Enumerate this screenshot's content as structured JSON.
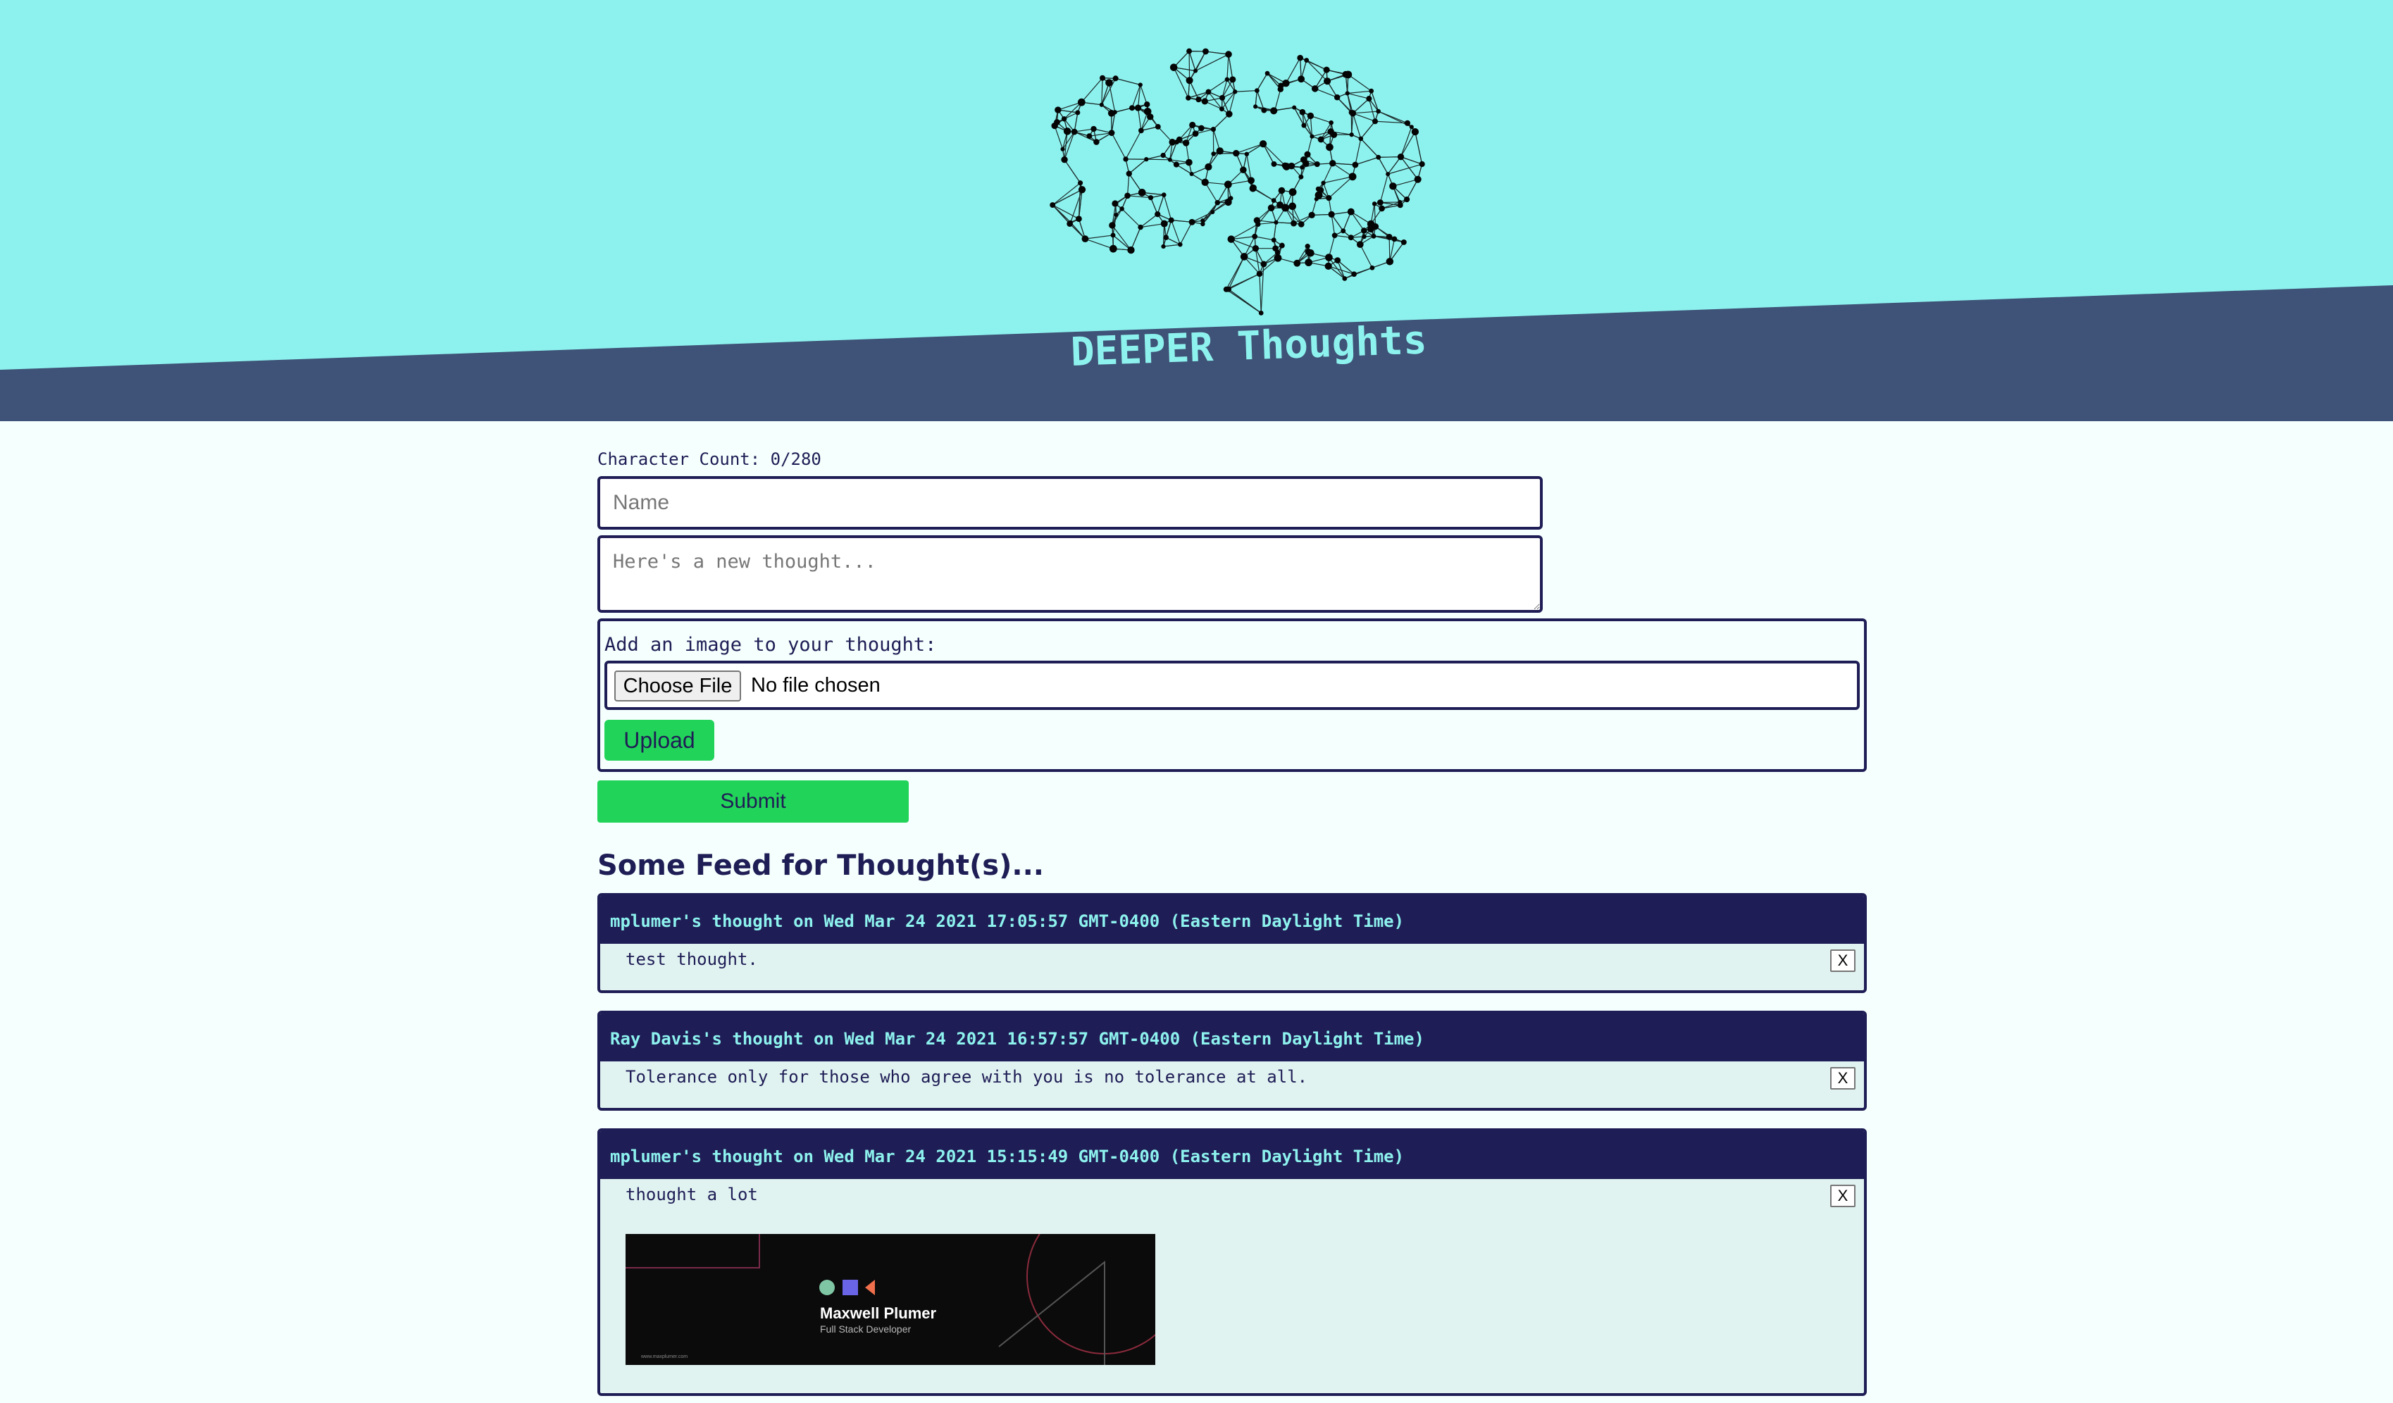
{
  "header": {
    "title": "DEEPER Thoughts",
    "colors": {
      "band": "#3f5277",
      "sky": "#8df2ee",
      "title": "#8df2ee"
    }
  },
  "form": {
    "char_count_label": "Character Count: 0/280",
    "name_placeholder": "Name",
    "thought_placeholder": "Here's a new thought...",
    "image_label": "Add an image to your thought:",
    "file_button_label": "Choose File",
    "file_status": "No file chosen",
    "upload_label": "Upload",
    "submit_label": "Submit"
  },
  "feed": {
    "title": "Some Feed for Thought(s)...",
    "delete_label": "X",
    "thoughts": [
      {
        "heading": "mplumer's thought on Wed Mar 24 2021 17:05:57 GMT-0400 (Eastern Daylight Time)",
        "text": "test thought."
      },
      {
        "heading": "Ray Davis's thought on Wed Mar 24 2021 16:57:57 GMT-0400 (Eastern Daylight Time)",
        "text": "Tolerance only for those who agree with you is no tolerance at all."
      },
      {
        "heading": "mplumer's thought on Wed Mar 24 2021 15:15:49 GMT-0400 (Eastern Daylight Time)",
        "text": "thought a lot",
        "image": {
          "name": "Maxwell Plumer",
          "subtitle": "Full Stack Developer",
          "url_text": "www.maxplumer.com"
        }
      }
    ]
  },
  "colors": {
    "accent_green": "#22d35a",
    "navy": "#1f1d55",
    "card_bg": "#e0f3f1",
    "page_bg": "#f5fffd"
  }
}
